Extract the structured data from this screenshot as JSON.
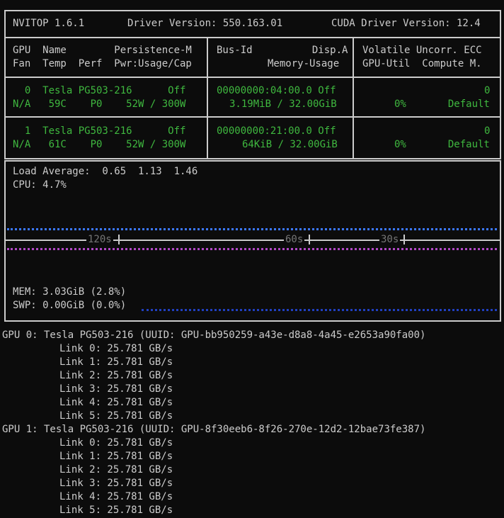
{
  "header": {
    "app": "NVITOP 1.6.1",
    "driver": "Driver Version: 550.163.01",
    "cuda": "CUDA Driver Version: 12.4"
  },
  "columns": {
    "c1_top": "GPU  Name        Persistence-M",
    "c1_bot": "Fan  Temp  Perf  Pwr:Usage/Cap",
    "c2_top": "Bus-Id          Disp.A",
    "c2_bot": "Memory-Usage",
    "c3_top": "Volatile Uncorr. ECC",
    "c3_bot": "GPU-Util  Compute M."
  },
  "gpus": [
    {
      "row1_left": "  0  Tesla PG503-216      Off",
      "row2_left": "N/A   59C    P0    52W / 300W",
      "row1_mid": "00000000:04:00.0 Off",
      "row2_mid": "3.19MiB / 32.00GiB",
      "row1_right": "0",
      "row2_right": "0%       Default"
    },
    {
      "row1_left": "  1  Tesla PG503-216      Off",
      "row2_left": "N/A   61C    P0    52W / 300W",
      "row1_mid": "00000000:21:00.0 Off",
      "row2_mid": "64KiB / 32.00GiB",
      "row1_right": "0",
      "row2_right": "0%       Default"
    }
  ],
  "system": {
    "load": "Load Average:  0.65  1.13  1.46",
    "cpu": "CPU: 4.7%",
    "mem": "MEM: 3.03GiB (2.8%)",
    "swp": "SWP: 0.00GiB (0.0%)",
    "axis": [
      "120s",
      "60s",
      "30s"
    ]
  },
  "nvlink": [
    {
      "title": "GPU 0: Tesla PG503-216 (UUID: GPU-bb950259-a43e-d8a8-4a45-e2653a90fa00)",
      "links": [
        "Link 0: 25.781 GB/s",
        "Link 1: 25.781 GB/s",
        "Link 2: 25.781 GB/s",
        "Link 3: 25.781 GB/s",
        "Link 4: 25.781 GB/s",
        "Link 5: 25.781 GB/s"
      ]
    },
    {
      "title": "GPU 1: Tesla PG503-216 (UUID: GPU-8f30eeb6-8f26-270e-12d2-12bae73fe387)",
      "links": [
        "Link 0: 25.781 GB/s",
        "Link 1: 25.781 GB/s",
        "Link 2: 25.781 GB/s",
        "Link 3: 25.781 GB/s",
        "Link 4: 25.781 GB/s",
        "Link 5: 25.781 GB/s"
      ]
    }
  ]
}
